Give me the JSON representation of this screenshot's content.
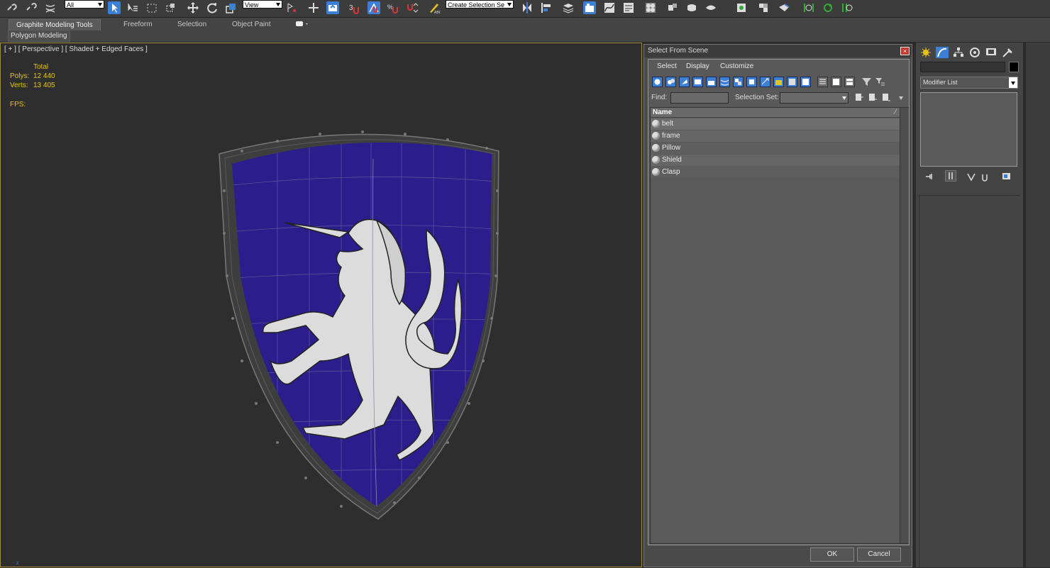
{
  "toolbar": {
    "selection_filter": "All",
    "reference_coord": "View",
    "named_selection_placeholder": "Create Selection Se"
  },
  "ribbon": {
    "tabs": [
      "Graphite Modeling Tools",
      "Freeform",
      "Selection",
      "Object Paint"
    ],
    "subtab": "Polygon Modeling"
  },
  "viewport": {
    "label": "[ + ] [ Perspective ] [ Shaded + Edged Faces ]",
    "stats": {
      "total_label": "Total",
      "polys_label": "Polys:",
      "polys_value": "12 440",
      "verts_label": "Verts:",
      "verts_value": "13 405",
      "fps_label": "FPS:"
    },
    "axis_label": "z"
  },
  "dialog": {
    "title": "Select From Scene",
    "menu": [
      "Select",
      "Display",
      "Customize"
    ],
    "find_label": "Find:",
    "selection_set_label": "Selection Set:",
    "list_header": "Name",
    "objects": [
      "belt",
      "frame",
      "Pillow",
      "Shield",
      "Clasp"
    ],
    "ok_label": "OK",
    "cancel_label": "Cancel"
  },
  "command_panel": {
    "modifier_list": "Modifier List"
  },
  "colors": {
    "shield_blue": "#2b1d8c",
    "highlight": "#3b7fd6",
    "viewport_stats": "#e8c320"
  }
}
